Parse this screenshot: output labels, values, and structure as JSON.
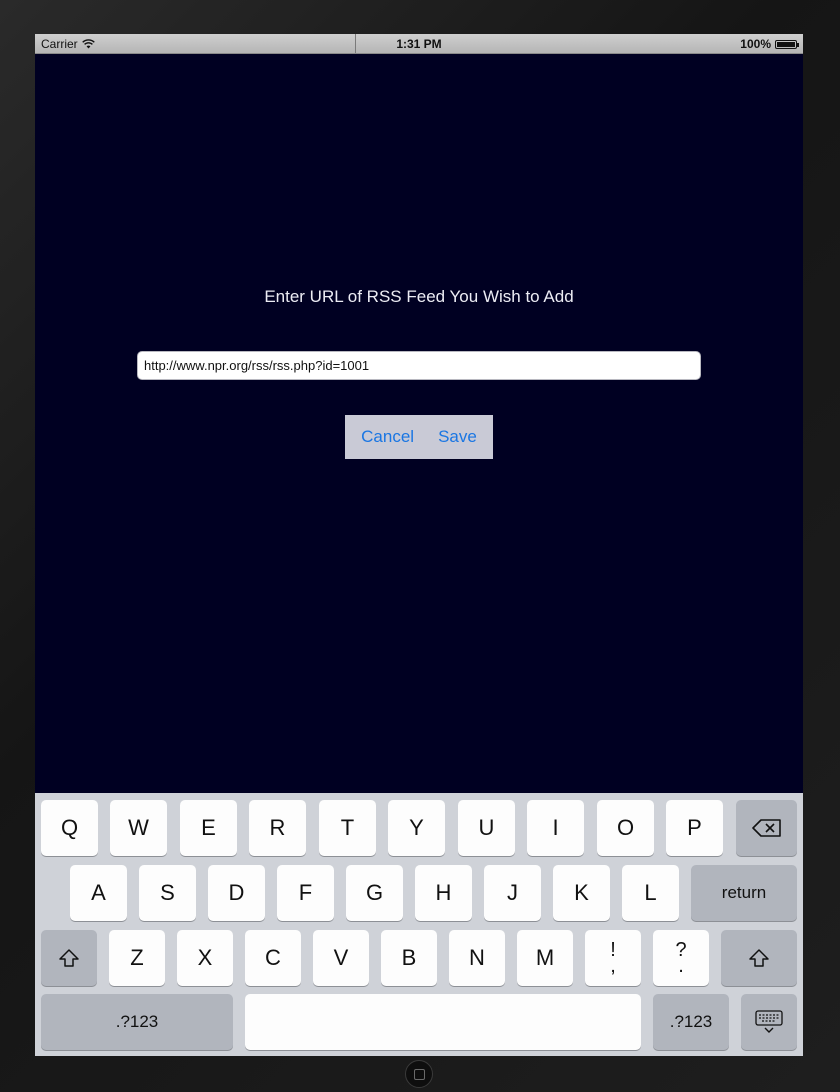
{
  "status_bar": {
    "carrier": "Carrier",
    "time": "1:31 PM",
    "battery": "100%"
  },
  "dialog": {
    "prompt": "Enter URL of RSS Feed You Wish to Add",
    "url_value": "http://www.npr.org/rss/rss.php?id=1001",
    "cancel_label": "Cancel",
    "save_label": "Save"
  },
  "keyboard": {
    "row1": [
      "Q",
      "W",
      "E",
      "R",
      "T",
      "Y",
      "U",
      "I",
      "O",
      "P"
    ],
    "row2": [
      "A",
      "S",
      "D",
      "F",
      "G",
      "H",
      "J",
      "K",
      "L"
    ],
    "row3": [
      "Z",
      "X",
      "C",
      "V",
      "B",
      "N",
      "M"
    ],
    "punct1": {
      "top": "!",
      "bottom": ","
    },
    "punct2": {
      "top": "?",
      "bottom": "."
    },
    "return_label": "return",
    "numbers_label": ".?123"
  },
  "colors": {
    "background": "#000022",
    "accent": "#1a76e3"
  }
}
